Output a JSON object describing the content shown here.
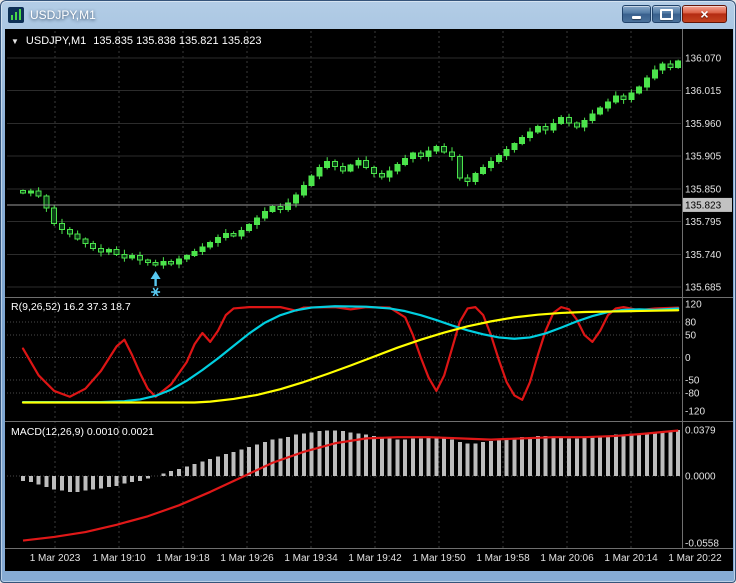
{
  "window": {
    "title": "USDJPY,M1"
  },
  "icons": {
    "dropdown": "▼",
    "close": "×",
    "app": "chart-icon",
    "buy_marker": "up-arrow-with-star"
  },
  "quote": {
    "symbol": "USDJPY,M1",
    "ohlc": "135.835 135.838 135.821 135.823"
  },
  "colors": {
    "bg": "#000000",
    "grid_h": "#2c2c2c",
    "grid_v": "#3a3a3a",
    "levels": "#4a4a4a",
    "separator": "#6f6f6f",
    "axis_text": "#e2e2e2",
    "candle": "#4ce44c",
    "candle_down_fill": "#0b3f16",
    "bid_line": "#9a9a9a",
    "bid_box_bg": "#c2c2c2",
    "bid_box_text": "#000000",
    "osc_red": "#dd1515",
    "osc_cyan": "#00cfe0",
    "osc_yellow": "#ffff00",
    "macd_hist": "#bdbdbd",
    "macd_signal": "#e01818",
    "marker": "#58c8f0"
  },
  "time_axis": [
    "1 Mar 2023",
    "1 Mar 19:10",
    "1 Mar 19:18",
    "1 Mar 19:26",
    "1 Mar 19:34",
    "1 Mar 19:42",
    "1 Mar 19:50",
    "1 Mar 19:58",
    "1 Mar 20:06",
    "1 Mar 20:14",
    "1 Mar 20:22"
  ],
  "chart_data": [
    {
      "type": "candlestick",
      "symbol": "USDJPY",
      "timeframe": "M1",
      "title": "USDJPY,M1 price panel",
      "y_tick_labels": [
        "136.070",
        "136.015",
        "135.960",
        "135.905",
        "135.850",
        "135.795",
        "135.740",
        "135.685"
      ],
      "y_tick_values": [
        136.07,
        136.015,
        135.96,
        135.905,
        135.85,
        135.795,
        135.74,
        135.685
      ],
      "ylim": [
        135.67,
        136.1
      ],
      "current_price": 135.823,
      "current_price_label": "135.823",
      "closes": [
        135.843,
        135.846,
        135.838,
        135.818,
        135.792,
        135.782,
        135.774,
        135.766,
        135.758,
        135.75,
        135.744,
        135.748,
        135.74,
        135.734,
        135.738,
        135.73,
        135.726,
        135.722,
        135.728,
        135.724,
        135.732,
        135.738,
        135.745,
        135.752,
        135.76,
        135.768,
        135.775,
        135.771,
        135.78,
        135.79,
        135.801,
        135.812,
        135.82,
        135.815,
        135.826,
        135.84,
        135.856,
        135.872,
        135.886,
        135.896,
        135.888,
        135.88,
        135.89,
        135.898,
        135.886,
        135.876,
        135.87,
        135.88,
        135.891,
        135.901,
        135.91,
        135.904,
        135.914,
        135.921,
        135.912,
        135.904,
        135.868,
        135.862,
        135.876,
        135.886,
        135.896,
        135.906,
        135.916,
        135.926,
        135.936,
        135.946,
        135.955,
        135.949,
        135.96,
        135.97,
        135.961,
        135.954,
        135.965,
        135.976,
        135.986,
        135.996,
        136.006,
        136.0,
        136.011,
        136.021,
        136.036,
        136.05,
        136.06,
        136.054,
        136.065
      ],
      "marker": {
        "type": "buy-arrow-and-star",
        "candle_index": 17,
        "price": 135.712
      }
    },
    {
      "type": "line",
      "label": "R(9,26,52) 16.2 37.3 18.7",
      "y_tick_labels": [
        "120",
        "80",
        "50",
        "0",
        "-50",
        "-80",
        "-120"
      ],
      "y_tick_values": [
        120,
        80,
        50,
        0,
        -50,
        -80,
        -120
      ],
      "level_lines": [
        80,
        50,
        0,
        -50,
        -80
      ],
      "ylim": [
        -120,
        120
      ],
      "series": [
        {
          "name": "fast-red",
          "points": [
            [
              0,
              20
            ],
            [
              2,
              -40
            ],
            [
              4,
              -75
            ],
            [
              6,
              -88
            ],
            [
              8,
              -70
            ],
            [
              10,
              -30
            ],
            [
              12,
              25
            ],
            [
              13,
              40
            ],
            [
              14,
              5
            ],
            [
              15,
              -35
            ],
            [
              16,
              -70
            ],
            [
              17,
              -88
            ],
            [
              19,
              -60
            ],
            [
              21,
              -10
            ],
            [
              22,
              30
            ],
            [
              23,
              55
            ],
            [
              24,
              35
            ],
            [
              25,
              60
            ],
            [
              26,
              95
            ],
            [
              27,
              110
            ],
            [
              29,
              113
            ],
            [
              33,
              113
            ],
            [
              35,
              105
            ],
            [
              36,
              112
            ],
            [
              40,
              113
            ],
            [
              42,
              108
            ],
            [
              44,
              113
            ],
            [
              47,
              112
            ],
            [
              49,
              90
            ],
            [
              50,
              50
            ],
            [
              51,
              0
            ],
            [
              52,
              -45
            ],
            [
              53,
              -75
            ],
            [
              54,
              -40
            ],
            [
              55,
              20
            ],
            [
              56,
              80
            ],
            [
              57,
              110
            ],
            [
              58,
              113
            ],
            [
              59,
              95
            ],
            [
              60,
              50
            ],
            [
              61,
              -5
            ],
            [
              62,
              -55
            ],
            [
              63,
              -85
            ],
            [
              64,
              -95
            ],
            [
              65,
              -55
            ],
            [
              66,
              5
            ],
            [
              67,
              60
            ],
            [
              68,
              100
            ],
            [
              69,
              113
            ],
            [
              70,
              108
            ],
            [
              71,
              85
            ],
            [
              72,
              50
            ],
            [
              73,
              35
            ],
            [
              74,
              60
            ],
            [
              75,
              95
            ],
            [
              76,
              110
            ],
            [
              77,
              113
            ],
            [
              79,
              106
            ],
            [
              81,
              110
            ],
            [
              84,
              112
            ]
          ]
        },
        {
          "name": "mid-cyan",
          "points": [
            [
              0,
              -100
            ],
            [
              10,
              -100
            ],
            [
              13,
              -98
            ],
            [
              15,
              -94
            ],
            [
              17,
              -86
            ],
            [
              19,
              -72
            ],
            [
              21,
              -52
            ],
            [
              23,
              -28
            ],
            [
              25,
              -2
            ],
            [
              27,
              26
            ],
            [
              29,
              54
            ],
            [
              31,
              78
            ],
            [
              33,
              95
            ],
            [
              35,
              106
            ],
            [
              37,
              112
            ],
            [
              40,
              115
            ],
            [
              44,
              114
            ],
            [
              47,
              110
            ],
            [
              49,
              104
            ],
            [
              51,
              95
            ],
            [
              53,
              84
            ],
            [
              55,
              72
            ],
            [
              57,
              61
            ],
            [
              59,
              52
            ],
            [
              61,
              45
            ],
            [
              63,
              42
            ],
            [
              65,
              45
            ],
            [
              67,
              54
            ],
            [
              69,
              67
            ],
            [
              71,
              81
            ],
            [
              73,
              93
            ],
            [
              75,
              102
            ],
            [
              77,
              107
            ],
            [
              79,
              108
            ],
            [
              81,
              107
            ],
            [
              84,
              110
            ]
          ]
        },
        {
          "name": "slow-yellow",
          "points": [
            [
              0,
              -101
            ],
            [
              22,
              -101
            ],
            [
              24,
              -99
            ],
            [
              27,
              -93
            ],
            [
              30,
              -84
            ],
            [
              33,
              -71
            ],
            [
              36,
              -55
            ],
            [
              39,
              -37
            ],
            [
              42,
              -18
            ],
            [
              45,
              2
            ],
            [
              48,
              22
            ],
            [
              51,
              40
            ],
            [
              54,
              56
            ],
            [
              57,
              70
            ],
            [
              60,
              81
            ],
            [
              63,
              90
            ],
            [
              66,
              96
            ],
            [
              69,
              100
            ],
            [
              72,
              102
            ],
            [
              75,
              103
            ],
            [
              78,
              104
            ],
            [
              81,
              105
            ],
            [
              84,
              106
            ]
          ]
        }
      ]
    },
    {
      "type": "histogram+line",
      "label": "MACD(12,26,9) 0.0010 0.0021",
      "y_tick_labels": [
        "0.0379",
        "0.0000",
        "-0.0558"
      ],
      "y_tick_values": [
        0.0379,
        0.0,
        -0.0558
      ],
      "ylim": [
        -0.0558,
        0.0379
      ],
      "histogram": [
        -0.004,
        -0.005,
        -0.007,
        -0.009,
        -0.011,
        -0.012,
        -0.013,
        -0.013,
        -0.012,
        -0.011,
        -0.01,
        -0.009,
        -0.008,
        -0.006,
        -0.005,
        -0.004,
        -0.002,
        0.0,
        0.002,
        0.004,
        0.006,
        0.008,
        0.01,
        0.012,
        0.014,
        0.016,
        0.018,
        0.02,
        0.022,
        0.024,
        0.026,
        0.028,
        0.03,
        0.031,
        0.032,
        0.034,
        0.035,
        0.036,
        0.037,
        0.0375,
        0.0375,
        0.037,
        0.036,
        0.035,
        0.034,
        0.033,
        0.032,
        0.031,
        0.03,
        0.03,
        0.031,
        0.031,
        0.032,
        0.032,
        0.031,
        0.03,
        0.028,
        0.027,
        0.027,
        0.028,
        0.029,
        0.03,
        0.031,
        0.031,
        0.032,
        0.032,
        0.033,
        0.033,
        0.032,
        0.032,
        0.031,
        0.031,
        0.032,
        0.032,
        0.033,
        0.033,
        0.034,
        0.034,
        0.035,
        0.035,
        0.036,
        0.036,
        0.037,
        0.037,
        0.038
      ],
      "signal": [
        [
          0,
          -0.053
        ],
        [
          4,
          -0.05
        ],
        [
          8,
          -0.046
        ],
        [
          12,
          -0.04
        ],
        [
          16,
          -0.033
        ],
        [
          20,
          -0.024
        ],
        [
          24,
          -0.013
        ],
        [
          28,
          -0.001
        ],
        [
          32,
          0.011
        ],
        [
          36,
          0.02
        ],
        [
          40,
          0.027
        ],
        [
          44,
          0.031
        ],
        [
          48,
          0.032
        ],
        [
          52,
          0.032
        ],
        [
          56,
          0.031
        ],
        [
          60,
          0.03
        ],
        [
          64,
          0.031
        ],
        [
          68,
          0.032
        ],
        [
          72,
          0.032
        ],
        [
          76,
          0.033
        ],
        [
          80,
          0.035
        ],
        [
          84,
          0.0375
        ]
      ]
    }
  ]
}
